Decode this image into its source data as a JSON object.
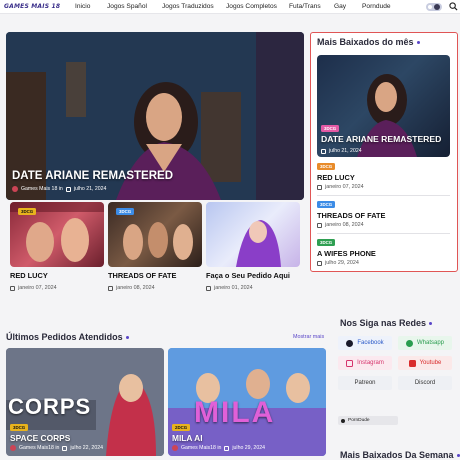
{
  "nav": {
    "logo": "GAMES MAIS 18",
    "items": [
      "Inicio",
      "Jogos Spañol",
      "Jogos Traduzidos",
      "Jogos Completos",
      "Futa/Trans",
      "Gay",
      "Porndude"
    ]
  },
  "hero": {
    "title": "DATE ARIANE REMASTERED",
    "author": "Games Mais 18 in",
    "date": "julho 21, 2024"
  },
  "cards": [
    {
      "badge": "3DCG",
      "title": "RED LUCY",
      "date": "janeiro 07, 2024"
    },
    {
      "badge": "3DCG",
      "title": "THREADS OF FATE",
      "date": "janeiro 08, 2024"
    },
    {
      "badge": "",
      "title": "Faça o Seu Pedido Aqui",
      "date": "janeiro 01, 2024"
    }
  ],
  "sidebar_top": {
    "heading": "Mais Baixados do mês",
    "feature": {
      "badge": "3DCG",
      "title": "DATE ARIANE REMASTERED",
      "date": "julho 21, 2024"
    },
    "items": [
      {
        "badge": "3DCG",
        "title": "RED LUCY",
        "date": "janeiro 07, 2024"
      },
      {
        "badge": "3DCG",
        "title": "THREADS OF FATE",
        "date": "janeiro 08, 2024"
      },
      {
        "badge": "3DCG",
        "title": "A WIFES PHONE",
        "date": "julho 29, 2024"
      }
    ]
  },
  "recent": {
    "heading": "Últimos Pedidos Atendidos",
    "more": "Mostrar mais",
    "posts": [
      {
        "badge": "3DCG",
        "art_text": "CORPS",
        "title": "SPACE CORPS",
        "author": "Games Mais18 in",
        "date": "julho 22, 2024"
      },
      {
        "badge": "2DCG",
        "art_text": "MILA",
        "title": "MILA AI",
        "author": "Games Mais18 in",
        "date": "julho 29, 2024"
      }
    ]
  },
  "follow": {
    "heading": "Nos Siga nas Redes",
    "links": [
      "Facebook",
      "Whatsapp",
      "Instagram",
      "Youtube",
      "Patreon",
      "Discord"
    ],
    "porndude": "PornDude"
  },
  "week": {
    "heading": "Mais Baixados Da Semana"
  },
  "colors": {
    "accent": "#5a46c8",
    "highlight_border": "#e05555"
  }
}
